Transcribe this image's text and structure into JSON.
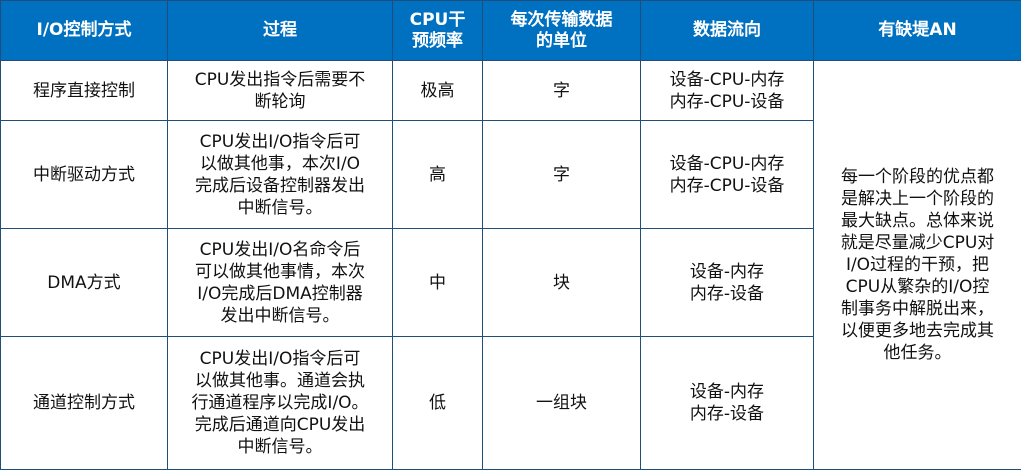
{
  "table": {
    "headers": [
      [
        "I/O控制方式"
      ],
      [
        "过程"
      ],
      [
        "CPU干",
        "预频率"
      ],
      [
        "每次传输数据",
        "的单位"
      ],
      [
        "数据流向"
      ],
      [
        "有缺堤AN"
      ]
    ],
    "rows": [
      {
        "method": "程序直接控制",
        "process": [
          "CPU发出指令后需要不",
          "断轮询"
        ],
        "frequency": "极高",
        "unit": "字",
        "flow": [
          "设备-CPU-内存",
          "内存-CPU-设备"
        ]
      },
      {
        "method": "中断驱动方式",
        "process": [
          "CPU发出I/O指令后可",
          "以做其他事，本次I/O",
          "完成后设备控制器发出",
          "中断信号。"
        ],
        "frequency": "高",
        "unit": "字",
        "flow": [
          "设备-CPU-内存",
          "内存-CPU-设备"
        ]
      },
      {
        "method": "DMA方式",
        "process": [
          "CPU发出I/O名命令后",
          "可以做其他事情，本次",
          "I/O完成后DMA控制器",
          "发出中断信号。"
        ],
        "frequency": "中",
        "unit": "块",
        "flow": [
          "设备-内存",
          "内存-设备"
        ]
      },
      {
        "method": "通道控制方式",
        "process": [
          "CPU发出I/O指令后可",
          "以做其他事。通道会执",
          "行通道程序以完成I/O。",
          "完成后通道向CPU发出",
          "中断信号。"
        ],
        "frequency": "低",
        "unit": "一组块",
        "flow": [
          "设备-内存",
          "内存-设备"
        ]
      }
    ],
    "advantages": [
      "每一个阶段的优点都",
      "是解决上一个阶段的",
      "最大缺点。总体来说",
      "就是尽量减少CPU对",
      "I/O过程的干预，把",
      "CPU从繁杂的I/O控",
      "制事务中解脱出来，",
      "以便更多地去完成其",
      "他任务。"
    ],
    "colors": {
      "header_bg": "#0070c0",
      "header_text": "#ffffff",
      "border": "#1f4e79",
      "body_text": "#111111"
    }
  }
}
